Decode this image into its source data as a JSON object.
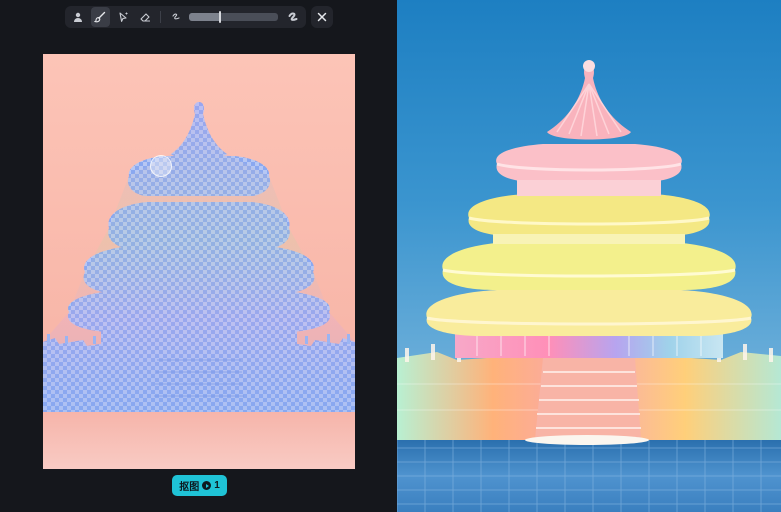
{
  "toolbar": {
    "tools": [
      {
        "name": "portrait-select-tool",
        "icon": "person-icon",
        "active": false
      },
      {
        "name": "brush-tool",
        "icon": "brush-icon",
        "active": true
      },
      {
        "name": "smart-select-tool",
        "icon": "cursor-sparkle-icon",
        "active": false
      },
      {
        "name": "eraser-tool",
        "icon": "eraser-icon",
        "active": false
      }
    ],
    "brush_size_fraction": 0.35,
    "small_brush_icon": "small-brush-icon",
    "large_brush_icon": "large-brush-icon",
    "close_icon": "close-icon"
  },
  "action": {
    "cutout_label": "抠图",
    "credit_cost": "1",
    "credit_icon": "play-coin-icon",
    "accent": "#1fc3d6"
  },
  "colors": {
    "mask": "#6f9cf0",
    "editor_bg": "#15171c",
    "canvas_bg": "#fcc4b7",
    "sky": "#1d7fc2"
  }
}
